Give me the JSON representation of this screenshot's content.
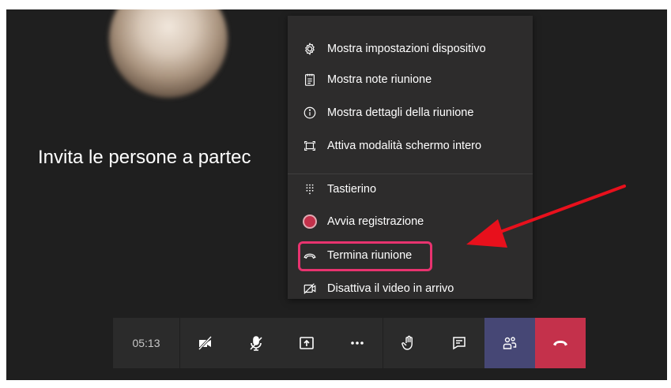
{
  "stage": {
    "invite_text": "Invita le persone a partec"
  },
  "menu": {
    "items": [
      {
        "label": "Mostra impostazioni dispositivo",
        "icon": "gear-icon"
      },
      {
        "label": "Mostra note riunione",
        "icon": "notes-icon"
      },
      {
        "label": "Mostra dettagli della riunione",
        "icon": "info-icon"
      },
      {
        "label": "Attiva modalità schermo intero",
        "icon": "fullscreen-icon"
      },
      {
        "label": "Tastierino",
        "icon": "dialpad-icon"
      },
      {
        "label": "Avvia registrazione",
        "icon": "record-icon"
      },
      {
        "label": "Termina riunione",
        "icon": "end-call-icon"
      },
      {
        "label": "Disattiva il video in arrivo",
        "icon": "video-off-icon"
      }
    ]
  },
  "toolbar": {
    "timer": "05:13",
    "buttons": [
      "video-off-icon",
      "mic-off-icon",
      "share-screen-icon",
      "more-icon",
      "raise-hand-icon",
      "chat-icon",
      "participants-icon",
      "hang-up-icon"
    ]
  },
  "colors": {
    "background": "#1f1f1f",
    "menu": "#2d2c2c",
    "toolbar": "#2b2b2b",
    "participants_active": "#464775",
    "hang_up": "#c4314b",
    "highlight": "#e8336f",
    "arrow": "#e8101c"
  }
}
